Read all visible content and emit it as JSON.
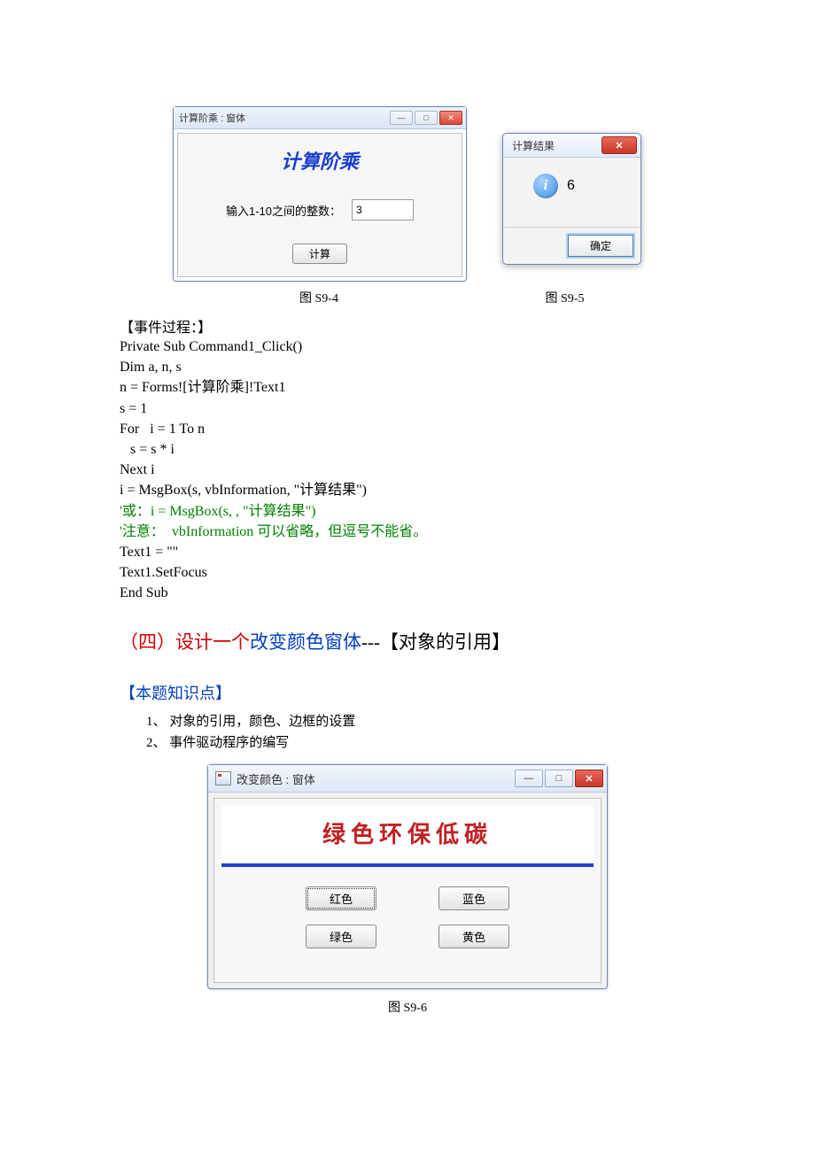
{
  "window1": {
    "title": "计算阶乘 : 窗体",
    "heading": "计算阶乘",
    "prompt": "输入1-10之间的整数：",
    "value": "3",
    "button": "计算"
  },
  "window2": {
    "title": "计算结果",
    "icon_letter": "i",
    "result": "6",
    "ok": "确定"
  },
  "captions": {
    "fig1": "图 S9-4",
    "fig2": "图 S9-5",
    "fig3": "图 S9-6"
  },
  "event_head": "【事件过程：】",
  "code": {
    "l1": "Private Sub Command1_Click()",
    "l2": "Dim a, n, s",
    "l3": "n = Forms![计算阶乘]!Text1",
    "l4": "s = 1",
    "l5": "For   i = 1 To n",
    "l6": "   s = s * i",
    "l7": "Next i",
    "l8": "i = MsgBox(s, vbInformation, \"计算结果\")",
    "l9": "'或：i = MsgBox(s, , \"计算结果\")",
    "l10": "'注意：  vbInformation 可以省略，但逗号不能省。",
    "l11": "Text1 = \"\"",
    "l12": "Text1.SetFocus",
    "l13": "End Sub"
  },
  "section4": {
    "prefix": "（四）设计一个",
    "mid": "改变颜色窗体",
    "suffix": "---【对象的引用】"
  },
  "knowledge": {
    "head": "【本题知识点】",
    "p1": "1、 对象的引用，颜色、边框的设置",
    "p2": "2、 事件驱动程序的编写"
  },
  "window3": {
    "title": "改变颜色 : 窗体",
    "banner": "绿色环保低碳",
    "btn_red": "红色",
    "btn_blue": "蓝色",
    "btn_green": "绿色",
    "btn_yellow": "黄色"
  }
}
